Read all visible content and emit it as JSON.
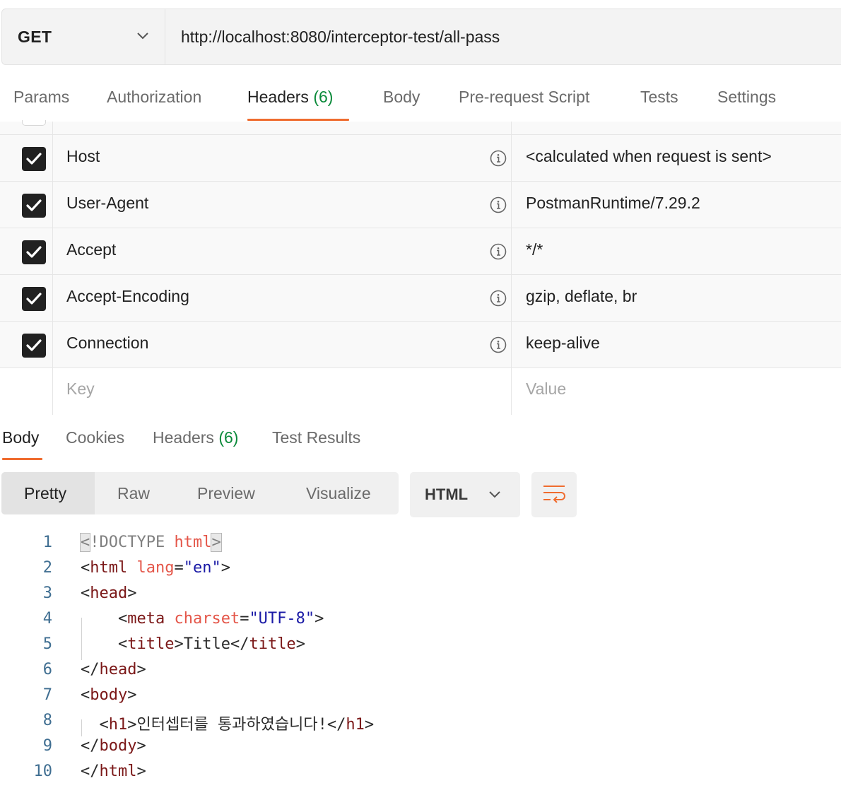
{
  "request": {
    "method": "GET",
    "url": "http://localhost:8080/interceptor-test/all-pass"
  },
  "request_tabs": [
    {
      "label": "Params",
      "count": ""
    },
    {
      "label": "Authorization",
      "count": ""
    },
    {
      "label": "Headers",
      "count": "(6)"
    },
    {
      "label": "Body",
      "count": ""
    },
    {
      "label": "Pre-request Script",
      "count": ""
    },
    {
      "label": "Tests",
      "count": ""
    },
    {
      "label": "Settings",
      "count": ""
    }
  ],
  "active_request_tab": "Headers",
  "headers": [
    {
      "key": "Host",
      "value": "<calculated when request is sent>",
      "checked": true
    },
    {
      "key": "User-Agent",
      "value": "PostmanRuntime/7.29.2",
      "checked": true
    },
    {
      "key": "Accept",
      "value": "*/*",
      "checked": true
    },
    {
      "key": "Accept-Encoding",
      "value": "gzip, deflate, br",
      "checked": true
    },
    {
      "key": "Connection",
      "value": "keep-alive",
      "checked": true
    }
  ],
  "new_header": {
    "key_placeholder": "Key",
    "value_placeholder": "Value"
  },
  "response_tabs": [
    {
      "label": "Body",
      "count": ""
    },
    {
      "label": "Cookies",
      "count": ""
    },
    {
      "label": "Headers",
      "count": "(6)"
    },
    {
      "label": "Test Results",
      "count": ""
    }
  ],
  "active_response_tab": "Body",
  "view_modes": [
    "Pretty",
    "Raw",
    "Preview",
    "Visualize"
  ],
  "active_view_mode": "Pretty",
  "language": "HTML",
  "code_lines": [
    {
      "n": "1",
      "text": "<!DOCTYPE html>"
    },
    {
      "n": "2",
      "text": "<html lang=\"en\">"
    },
    {
      "n": "3",
      "text": "<head>"
    },
    {
      "n": "4",
      "text": "    <meta charset=\"UTF-8\">"
    },
    {
      "n": "5",
      "text": "    <title>Title</title>"
    },
    {
      "n": "6",
      "text": "</head>"
    },
    {
      "n": "7",
      "text": "<body>"
    },
    {
      "n": "8",
      "text": "  <h1>인터셉터를 통과하였습니다!</h1>"
    },
    {
      "n": "9",
      "text": "</body>"
    },
    {
      "n": "10",
      "text": "</html>"
    }
  ],
  "colors": {
    "accent": "#ef6c2f",
    "count_green": "#0b8a3a",
    "tag": "#7b1818",
    "attribute": "#e45649",
    "string": "#1a1aa6",
    "line_number": "#3f6e91"
  }
}
